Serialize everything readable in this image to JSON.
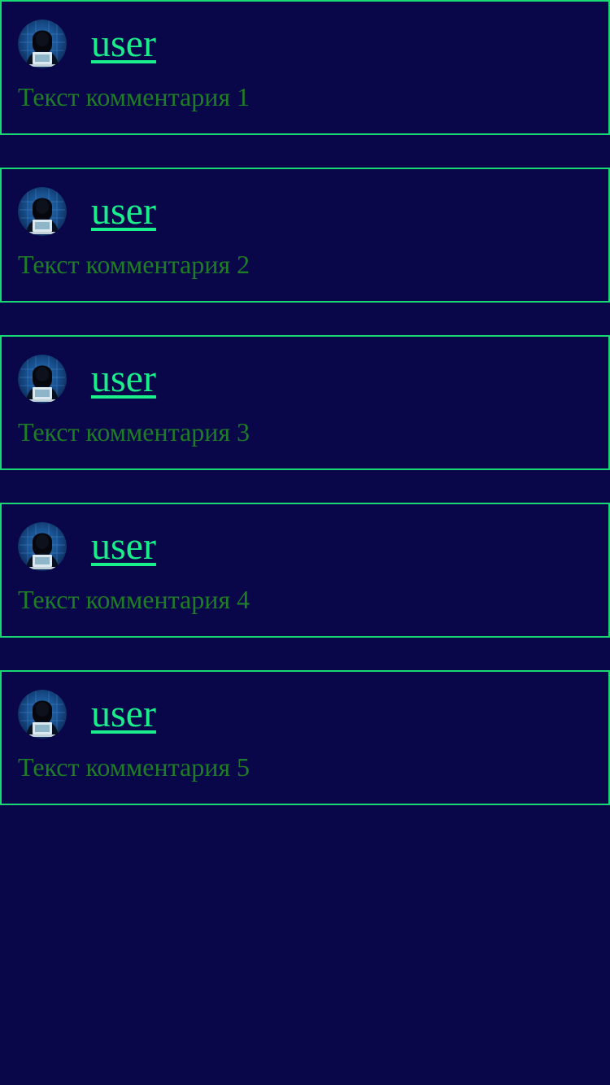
{
  "colors": {
    "background": "#0a064a",
    "border": "#18d873",
    "username": "#19ee8a",
    "comment_text": "#1e7d26"
  },
  "comments": [
    {
      "avatar_icon": "hacker-avatar-icon",
      "username": "user",
      "text": "Текст комментария 1"
    },
    {
      "avatar_icon": "hacker-avatar-icon",
      "username": "user",
      "text": "Текст комментария 2"
    },
    {
      "avatar_icon": "hacker-avatar-icon",
      "username": "user",
      "text": "Текст комментария 3"
    },
    {
      "avatar_icon": "hacker-avatar-icon",
      "username": "user",
      "text": "Текст комментария 4"
    },
    {
      "avatar_icon": "hacker-avatar-icon",
      "username": "user",
      "text": "Текст комментария 5"
    }
  ]
}
